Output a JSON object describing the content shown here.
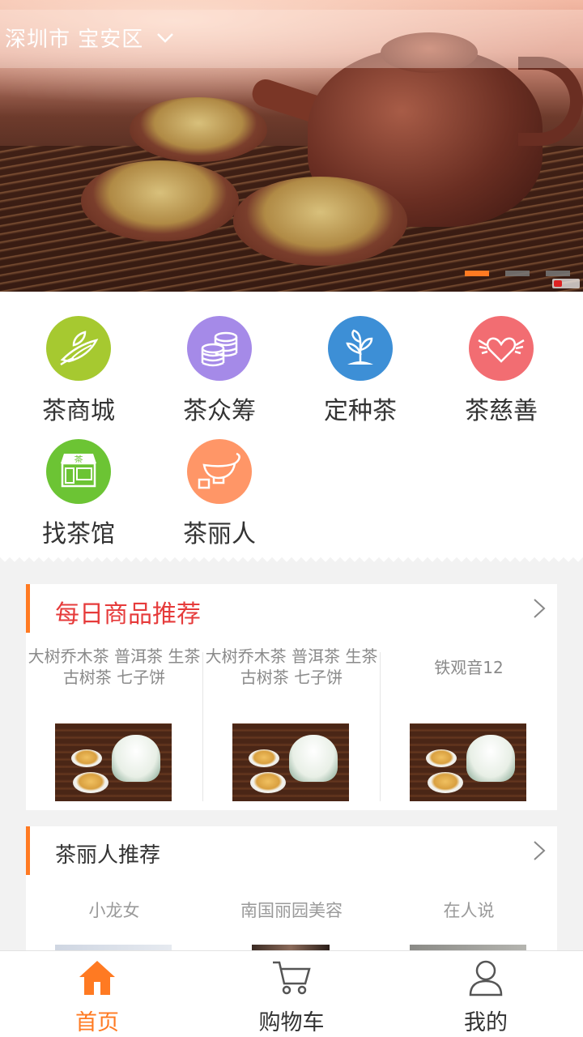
{
  "location": {
    "city": "深圳市 宝安区"
  },
  "banner": {
    "slide_count": 3,
    "active_slide": 1
  },
  "menu": {
    "items": [
      {
        "label": "茶商城",
        "icon": "tea-leaf-icon",
        "color": "#a6c930"
      },
      {
        "label": "茶众筹",
        "icon": "coins-icon",
        "color": "#a58ae8"
      },
      {
        "label": "定种茶",
        "icon": "sprout-icon",
        "color": "#3d8fd6"
      },
      {
        "label": "茶慈善",
        "icon": "winged-heart-icon",
        "color": "#f26d72"
      },
      {
        "label": "找茶馆",
        "icon": "teahouse-icon",
        "color": "#6cc434"
      },
      {
        "label": "茶丽人",
        "icon": "teapot-icon",
        "color": "#ff9667"
      }
    ]
  },
  "daily": {
    "title": "每日商品推荐",
    "title_color": "#e63b3b",
    "products": [
      {
        "name": "大树乔木茶 普洱茶 生茶 古树茶 七子饼"
      },
      {
        "name": "大树乔木茶 普洱茶 生茶 古树茶 七子饼"
      },
      {
        "name": "铁观音12"
      }
    ]
  },
  "beauty": {
    "title": "茶丽人推荐",
    "people": [
      {
        "name": "小龙女"
      },
      {
        "name": "南国丽园美容"
      },
      {
        "name": "在人说"
      }
    ]
  },
  "tabbar": {
    "accent": "#ff7a22",
    "tabs": [
      {
        "label": "首页",
        "icon": "home-icon",
        "active": true
      },
      {
        "label": "购物车",
        "icon": "cart-icon",
        "active": false
      },
      {
        "label": "我的",
        "icon": "user-icon",
        "active": false
      }
    ]
  }
}
